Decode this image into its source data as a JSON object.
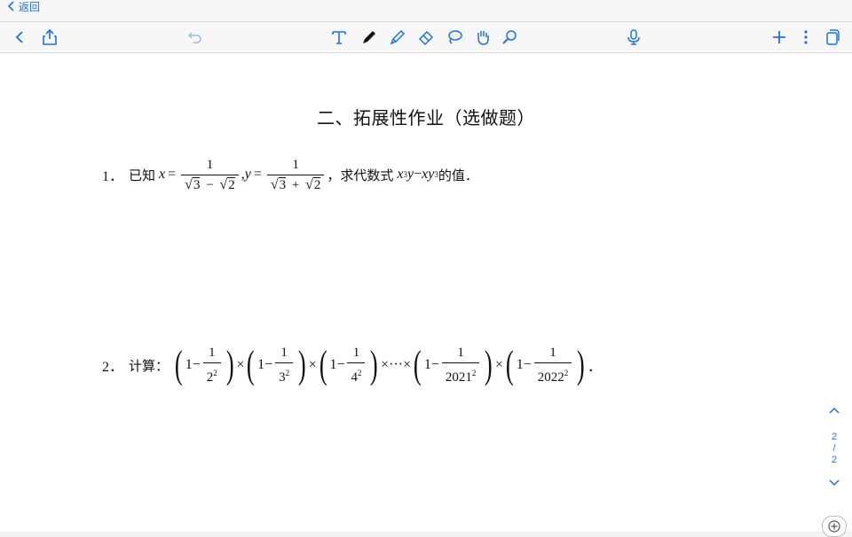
{
  "nav": {
    "back_label": "返回"
  },
  "toolbar": {
    "left": [
      "chevron-left-icon",
      "share-icon",
      "undo-icon"
    ],
    "tools": [
      "text-tool-icon",
      "pen-tool-icon",
      "highlighter-tool-icon",
      "eraser-tool-icon",
      "lasso-tool-icon",
      "hand-tool-icon",
      "laser-pointer-icon"
    ],
    "right": [
      "microphone-icon",
      "plus-icon",
      "more-icon",
      "pages-icon"
    ]
  },
  "document": {
    "title": "二、拓展性作业（选做题）",
    "q1": {
      "number": "1．",
      "prefix": "已知",
      "x_var": "x",
      "eq": "=",
      "num": "1",
      "den_a": "3",
      "minus": "−",
      "plus": "+",
      "den_b": "2",
      "comma": ",",
      "y_var": "y",
      "suffix": "，求代数式",
      "expr_x": "x",
      "exp3": "3",
      "expr_y": "y",
      "expr_mid": " − ",
      "expr_xy": "xy",
      "tail": "的值．"
    },
    "q2": {
      "number": "2．",
      "label": "计算：",
      "one": "1",
      "minus": "−",
      "times": "×",
      "dots": "×···×",
      "bases": [
        "2",
        "3",
        "4",
        "2021",
        "2022"
      ],
      "exp": "2",
      "end": "．"
    }
  },
  "pager": {
    "current": "2",
    "sep": "/",
    "total": "2"
  },
  "colors": {
    "accent": "#1a73e8",
    "ink": "#111111",
    "background": "#ffffff"
  }
}
